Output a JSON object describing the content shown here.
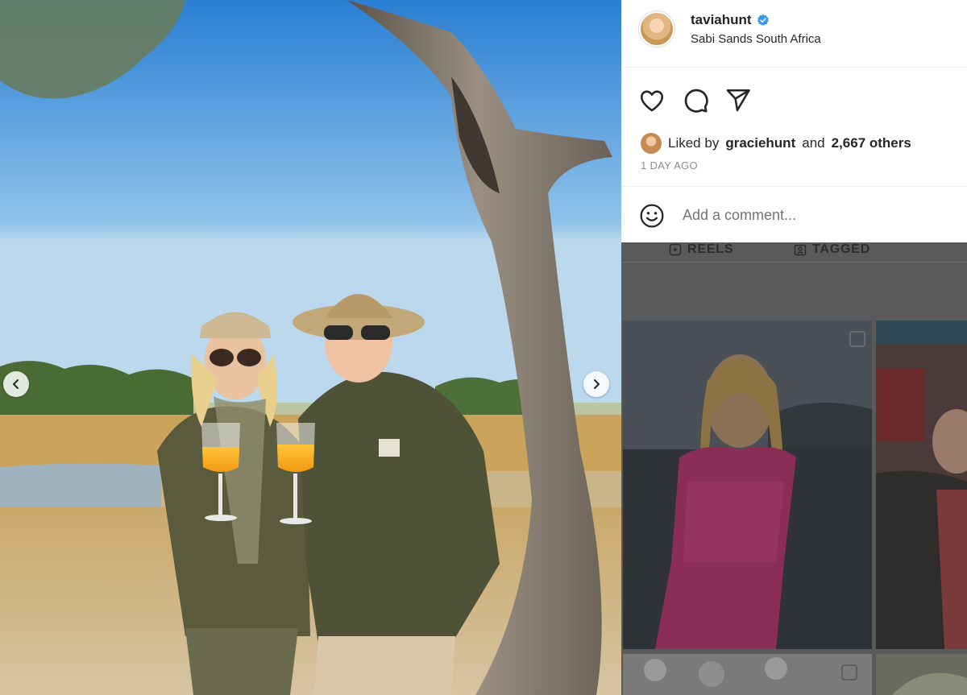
{
  "post": {
    "username": "taviahunt",
    "location": "Sabi Sands South Africa",
    "liked_by_prefix": "Liked by",
    "liked_by_user": "graciehunt",
    "liked_by_suffix_pre": "and",
    "liked_by_others": "2,667 others",
    "time_ago": "1 DAY AGO",
    "comment_placeholder": "Add a comment..."
  },
  "icons": {
    "verified": "verified-badge-icon",
    "like": "heart-icon",
    "comment": "comment-bubble-icon",
    "share": "paper-plane-icon",
    "emoji": "smiley-icon",
    "prev": "chevron-left-icon",
    "next": "chevron-right-icon",
    "reels": "reels-icon",
    "tagged": "tagged-icon"
  },
  "profile": {
    "tabs": [
      {
        "label": "REELS"
      },
      {
        "label": "TAGGED"
      }
    ]
  },
  "colors": {
    "verified_blue": "#3897f0",
    "text_primary": "#262626",
    "text_secondary": "#8e8e8e",
    "overlay_dim": "#5a5a5a"
  }
}
